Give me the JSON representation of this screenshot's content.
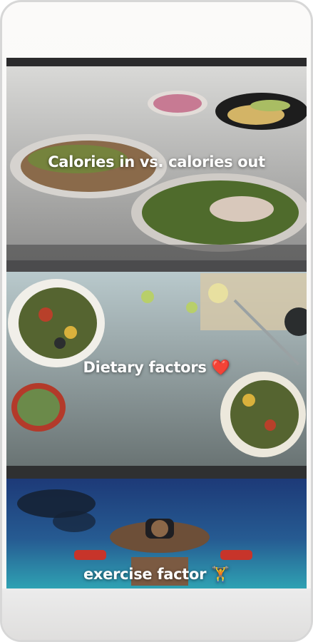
{
  "cards": [
    {
      "title": "Calories in vs. calories out",
      "emoji": ""
    },
    {
      "title": "Dietary factors",
      "emoji": "❤️"
    },
    {
      "title": "exercise factor",
      "emoji": "🏋️"
    }
  ]
}
